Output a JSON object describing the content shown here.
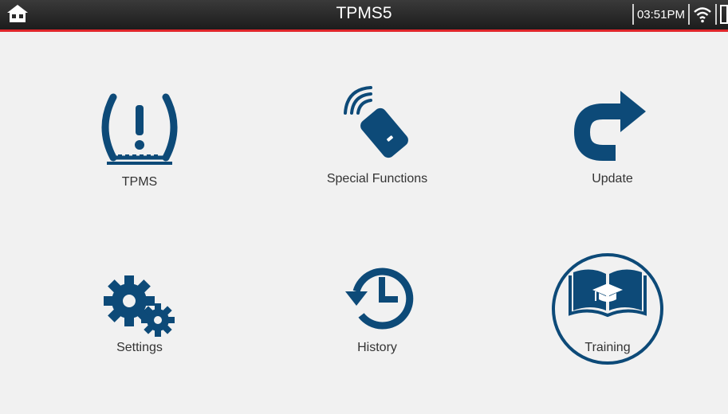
{
  "header": {
    "title": "TPMS5",
    "time": "03:51PM",
    "icons": [
      "home-icon",
      "wifi-icon",
      "battery-icon"
    ],
    "bar_color": "#e0262b"
  },
  "menu": {
    "accent_color": "#0d4a78",
    "items": [
      {
        "label": "TPMS",
        "icon": "tpms-warning-icon"
      },
      {
        "label": "Special Functions",
        "icon": "key-fob-signal-icon"
      },
      {
        "label": "Update",
        "icon": "redo-arrow-icon"
      },
      {
        "label": "Settings",
        "icon": "gears-icon"
      },
      {
        "label": "History",
        "icon": "clock-history-icon"
      },
      {
        "label": "Training",
        "icon": "graduation-book-icon",
        "highlighted": true
      }
    ]
  }
}
